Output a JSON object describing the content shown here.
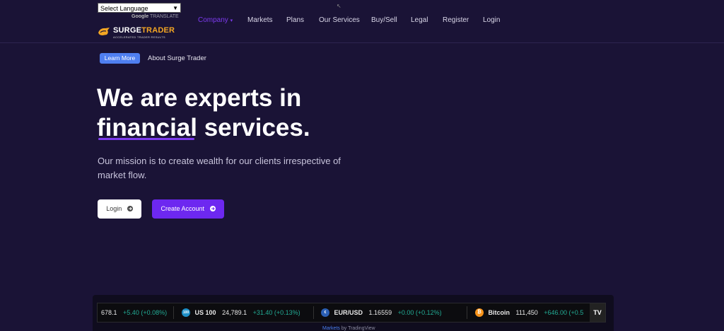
{
  "translate": {
    "select_label": "Select Language",
    "powered_brand": "Google",
    "powered_text": "TRANSLATE"
  },
  "brand": {
    "name_part1": "SURGE",
    "name_part2": "TRADER",
    "tagline": "ACCELERATED TRADER RESULTS",
    "accent_color": "#f4a623"
  },
  "nav": {
    "items": [
      {
        "label": "Company",
        "active": true,
        "has_dropdown": true
      },
      {
        "label": "Markets"
      },
      {
        "label": "Plans"
      },
      {
        "label": "Our Services"
      },
      {
        "label": "Buy/Sell"
      },
      {
        "label": "Legal"
      },
      {
        "label": "Register"
      },
      {
        "label": "Login"
      }
    ],
    "active_color": "#7c3aed"
  },
  "hero": {
    "badge": "Learn More",
    "badge_caption": "About Surge Trader",
    "headline_line1": "We are experts in",
    "headline_line2_a": "financial",
    "headline_line2_b": " services.",
    "mission": "Our mission is to create wealth for our clients irrespective of market flow.",
    "login_button": "Login",
    "create_button": "Create Account"
  },
  "ticker": {
    "items": [
      {
        "symbol": "",
        "price": "678.1",
        "change": "+5.40 (+0.08%)"
      },
      {
        "symbol": "US 100",
        "icon": "100",
        "price": "24,789.1",
        "change": "+31.40 (+0.13%)",
        "icon_color": "#1e8fc8"
      },
      {
        "symbol": "EUR/USD",
        "price": "1.16559",
        "change": "+0.00 (+0.12%)",
        "icon_color": "#2b5fb4"
      },
      {
        "symbol": "Bitcoin",
        "price": "111,450",
        "change": "+646.00 (+0.5",
        "icon_color": "#f7931a"
      }
    ],
    "tv_logo": "TV",
    "powered_link": "Markets",
    "powered_text": " by TradingView",
    "positive_color": "#22ab94"
  }
}
